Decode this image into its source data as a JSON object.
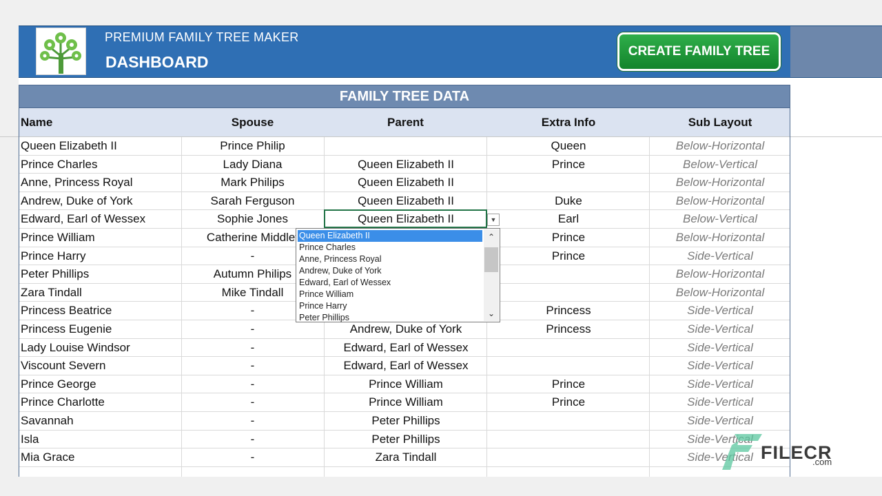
{
  "header": {
    "app_title": "PREMIUM FAMILY TREE MAKER",
    "page_title": "DASHBOARD",
    "create_button": "CREATE FAMILY TREE"
  },
  "table": {
    "title": "FAMILY TREE DATA",
    "columns": [
      "Name",
      "Spouse",
      "Parent",
      "Extra Info",
      "Sub Layout"
    ],
    "rows": [
      [
        "Queen Elizabeth II",
        "Prince Philip",
        "",
        "Queen",
        "Below-Horizontal"
      ],
      [
        "Prince Charles",
        "Lady Diana",
        "Queen Elizabeth II",
        "Prince",
        "Below-Vertical"
      ],
      [
        "Anne, Princess Royal",
        "Mark Philips",
        "Queen Elizabeth II",
        "",
        "Below-Horizontal"
      ],
      [
        "Andrew, Duke of York",
        "Sarah Ferguson",
        "Queen Elizabeth II",
        "Duke",
        "Below-Horizontal"
      ],
      [
        "Edward, Earl of Wessex",
        "Sophie Jones",
        "Queen Elizabeth II",
        "Earl",
        "Below-Vertical"
      ],
      [
        "Prince William",
        "Catherine Middlet",
        "",
        "Prince",
        "Below-Horizontal"
      ],
      [
        "Prince Harry",
        "-",
        "",
        "Prince",
        "Side-Vertical"
      ],
      [
        "Peter Phillips",
        "Autumn Philips",
        "",
        "",
        "Below-Horizontal"
      ],
      [
        "Zara Tindall",
        "Mike Tindall",
        "",
        "",
        "Below-Horizontal"
      ],
      [
        "Princess Beatrice",
        "-",
        "",
        "Princess",
        "Side-Vertical"
      ],
      [
        "Princess Eugenie",
        "-",
        "Andrew, Duke of York",
        "Princess",
        "Side-Vertical"
      ],
      [
        "Lady Louise Windsor",
        "-",
        "Edward, Earl of Wessex",
        "",
        "Side-Vertical"
      ],
      [
        "Viscount Severn",
        "-",
        "Edward, Earl of Wessex",
        "",
        "Side-Vertical"
      ],
      [
        "Prince George",
        "-",
        "Prince William",
        "Prince",
        "Side-Vertical"
      ],
      [
        "Prince Charlotte",
        "-",
        "Prince William",
        "Prince",
        "Side-Vertical"
      ],
      [
        "Savannah",
        "-",
        "Peter Phillips",
        "",
        "Side-Vertical"
      ],
      [
        "Isla",
        "-",
        "Peter Phillips",
        "",
        "Side-Vertical"
      ],
      [
        "Mia Grace",
        "-",
        "Zara Tindall",
        "",
        "Side-Vertical"
      ]
    ]
  },
  "dropdown": {
    "options": [
      "Queen Elizabeth II",
      "Prince Charles",
      "Anne, Princess Royal",
      "Andrew, Duke of York",
      "Edward, Earl of Wessex",
      "Prince William",
      "Prince Harry",
      "Peter Phillips"
    ],
    "selected": "Queen Elizabeth II"
  },
  "watermark": {
    "brand": "FILECR",
    "suffix": ".com"
  },
  "colors": {
    "banner": "#2f6fb4",
    "section_header": "#6e8ab0",
    "column_header": "#dbe3f1",
    "create_button": "#1f9a3c",
    "dropdown_selected": "#3b8ee8"
  }
}
